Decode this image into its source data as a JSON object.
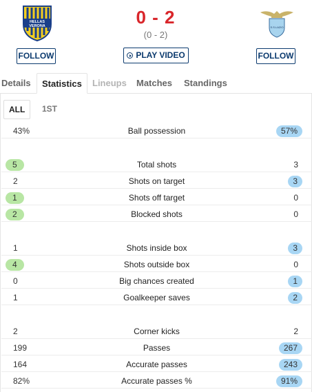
{
  "match": {
    "score": "0 - 2",
    "halftime": "(0 - 2)",
    "home_follow_label": "FOLLOW",
    "away_follow_label": "FOLLOW",
    "play_video_label": "PLAY VIDEO",
    "home_crest_text": "HELLAS VERONA",
    "away_crest_text": "S.S.LAZIO"
  },
  "tabs": [
    {
      "label": "Details",
      "state": "normal"
    },
    {
      "label": "Statistics",
      "state": "active"
    },
    {
      "label": "Lineups",
      "state": "disabled"
    },
    {
      "label": "Matches",
      "state": "normal"
    },
    {
      "label": "Standings",
      "state": "normal"
    }
  ],
  "subtabs": [
    {
      "label": "ALL",
      "state": "active"
    },
    {
      "label": "1ST",
      "state": "normal"
    }
  ],
  "colors": {
    "score": "#d9262b",
    "home_highlight": "#b8e6a4",
    "away_highlight": "#a8d6f4",
    "button_border": "#0b3a6e"
  },
  "stats": [
    {
      "label": "Ball possession",
      "home": "43%",
      "away": "57%",
      "leader": "away"
    },
    {
      "label": "Total shots",
      "home": "5",
      "away": "3",
      "leader": "home"
    },
    {
      "label": "Shots on target",
      "home": "2",
      "away": "3",
      "leader": "away"
    },
    {
      "label": "Shots off target",
      "home": "1",
      "away": "0",
      "leader": "home"
    },
    {
      "label": "Blocked shots",
      "home": "2",
      "away": "0",
      "leader": "home"
    },
    {
      "label": "Shots inside box",
      "home": "1",
      "away": "3",
      "leader": "away"
    },
    {
      "label": "Shots outside box",
      "home": "4",
      "away": "0",
      "leader": "home"
    },
    {
      "label": "Big chances created",
      "home": "0",
      "away": "1",
      "leader": "away"
    },
    {
      "label": "Goalkeeper saves",
      "home": "1",
      "away": "2",
      "leader": "away"
    },
    {
      "label": "Corner kicks",
      "home": "2",
      "away": "2",
      "leader": "none"
    },
    {
      "label": "Passes",
      "home": "199",
      "away": "267",
      "leader": "away"
    },
    {
      "label": "Accurate passes",
      "home": "164",
      "away": "243",
      "leader": "away"
    },
    {
      "label": "Accurate passes %",
      "home": "82%",
      "away": "91%",
      "leader": "away"
    }
  ]
}
